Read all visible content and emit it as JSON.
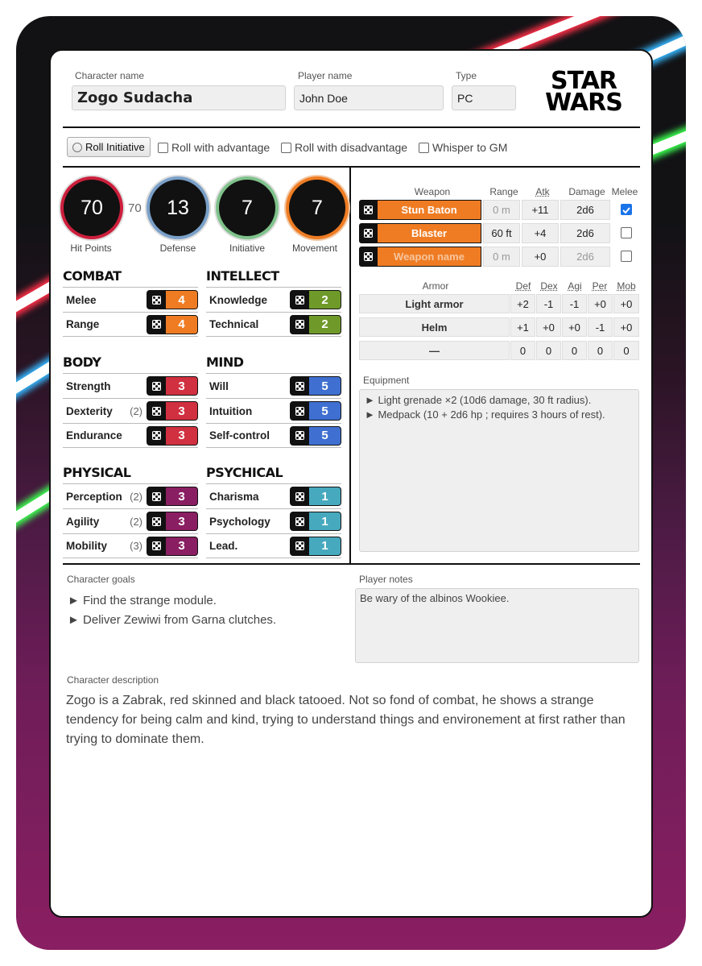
{
  "header": {
    "char_name_label": "Character name",
    "char_name": "Zogo Sudacha",
    "player_name_label": "Player name",
    "player_name": "John Doe",
    "type_label": "Type",
    "type": "PC",
    "logo_line1": "STAR",
    "logo_line2": "WARS"
  },
  "actions": {
    "roll_initiative": "Roll Initiative",
    "advantage": "Roll with advantage",
    "disadvantage": "Roll with disadvantage",
    "whisper": "Whisper to GM"
  },
  "vitals": {
    "hp": "70",
    "hp_max": "70",
    "hp_label": "Hit Points",
    "defense": "13",
    "defense_label": "Defense",
    "initiative": "7",
    "initiative_label": "Initiative",
    "movement": "7",
    "movement_label": "Movement",
    "colors": {
      "hp": "#cc1f3c",
      "defense": "#7aa0c8",
      "initiative": "#7fc28b",
      "movement": "#ef7c23"
    }
  },
  "skills": {
    "combat": {
      "title": "COMBAT",
      "color": "#ef7c23",
      "rows": [
        {
          "name": "Melee",
          "adv": "",
          "val": "4"
        },
        {
          "name": "Range",
          "adv": "",
          "val": "4"
        }
      ]
    },
    "intellect": {
      "title": "INTELLECT",
      "color": "#6f9a2a",
      "rows": [
        {
          "name": "Knowledge",
          "adv": "",
          "val": "2"
        },
        {
          "name": "Technical",
          "adv": "",
          "val": "2"
        }
      ]
    },
    "body": {
      "title": "BODY",
      "color": "#d13040",
      "rows": [
        {
          "name": "Strength",
          "adv": "",
          "val": "3"
        },
        {
          "name": "Dexterity",
          "adv": "(2)",
          "val": "3"
        },
        {
          "name": "Endurance",
          "adv": "",
          "val": "3"
        }
      ]
    },
    "mind": {
      "title": "MIND",
      "color": "#3f6fd0",
      "rows": [
        {
          "name": "Will",
          "adv": "",
          "val": "5"
        },
        {
          "name": "Intuition",
          "adv": "",
          "val": "5"
        },
        {
          "name": "Self-control",
          "adv": "",
          "val": "5"
        }
      ]
    },
    "physical": {
      "title": "PHYSICAL",
      "color": "#8a1e62",
      "rows": [
        {
          "name": "Perception",
          "adv": "(2)",
          "val": "3"
        },
        {
          "name": "Agility",
          "adv": "(2)",
          "val": "3"
        },
        {
          "name": "Mobility",
          "adv": "(3)",
          "val": "3"
        }
      ]
    },
    "psychical": {
      "title": "PSYCHICAL",
      "color": "#47a9be",
      "rows": [
        {
          "name": "Charisma",
          "adv": "",
          "val": "1"
        },
        {
          "name": "Psychology",
          "adv": "",
          "val": "1"
        },
        {
          "name": "Lead.",
          "adv": "",
          "val": "1"
        }
      ]
    }
  },
  "weapons": {
    "headers": {
      "weapon": "Weapon",
      "range": "Range",
      "atk": "Atk",
      "damage": "Damage",
      "melee": "Melee"
    },
    "rows": [
      {
        "name": "Stun Baton",
        "range": "0 m",
        "atk": "+11",
        "damage": "2d6",
        "melee": true
      },
      {
        "name": "Blaster",
        "range": "60 ft",
        "atk": "+4",
        "damage": "2d6",
        "melee": false
      },
      {
        "name": "Weapon name",
        "range": "0 m",
        "atk": "+0",
        "damage": "2d6",
        "melee": false
      }
    ]
  },
  "armor": {
    "headers": {
      "armor": "Armor",
      "def": "Def",
      "dex": "Dex",
      "agi": "Agi",
      "per": "Per",
      "mob": "Mob"
    },
    "rows": [
      {
        "name": "Light armor",
        "def": "+2",
        "dex": "-1",
        "agi": "-1",
        "per": "+0",
        "mob": "+0"
      },
      {
        "name": "Helm",
        "def": "+1",
        "dex": "+0",
        "agi": "+0",
        "per": "-1",
        "mob": "+0"
      },
      {
        "name": "—",
        "def": "0",
        "dex": "0",
        "agi": "0",
        "per": "0",
        "mob": "0"
      }
    ]
  },
  "equipment": {
    "label": "Equipment",
    "items": [
      "► Light grenade ×2 (10d6 damage, 30 ft radius).",
      "► Medpack (10 + 2d6 hp ; requires 3 hours of rest)."
    ]
  },
  "goals": {
    "label": "Character goals",
    "items": [
      "► Find the strange module.",
      "► Deliver Zewiwi from Garna clutches."
    ]
  },
  "notes": {
    "label": "Player notes",
    "text": "Be wary of the albinos Wookiee."
  },
  "description": {
    "label": "Character description",
    "text": "Zogo is a Zabrak, red skinned and black tatooed. Not so fond of combat, he shows a strange tendency for being calm and kind, trying to understand things and environement at first rather than trying to dominate them."
  }
}
